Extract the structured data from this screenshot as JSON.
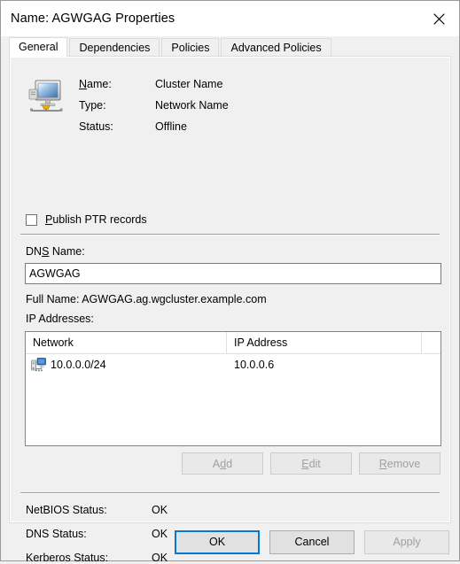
{
  "window": {
    "title": "Name: AGWGAG Properties",
    "close_icon": "close-icon"
  },
  "tabs": [
    {
      "label": "General",
      "active": true
    },
    {
      "label": "Dependencies",
      "active": false
    },
    {
      "label": "Policies",
      "active": false
    },
    {
      "label": "Advanced Policies",
      "active": false
    }
  ],
  "general": {
    "resource_icon": "network-name-resource-icon",
    "identity": [
      {
        "label": "Name:",
        "accel": "N",
        "value": "Cluster Name"
      },
      {
        "label": "Type:",
        "accel": "",
        "value": "Network Name"
      },
      {
        "label": "Status:",
        "accel": "",
        "value": "Offline"
      }
    ],
    "publish_ptr": {
      "label": "Publish PTR records",
      "accel": "P",
      "checked": false
    },
    "dns_name": {
      "label": "DNS Name:",
      "accel": "S",
      "value": "AGWGAG"
    },
    "full_name": "Full Name: AGWGAG.ag.wgcluster.example.com",
    "ip_addresses": {
      "label": "IP Addresses:",
      "columns": [
        "Network",
        "IP Address"
      ],
      "rows": [
        {
          "icon": "network-subnet-icon",
          "network": "10.0.0.0/24",
          "ip_address": "10.0.0.6"
        }
      ]
    },
    "list_buttons": [
      {
        "label": "Add",
        "accel": "d",
        "enabled": false
      },
      {
        "label": "Edit",
        "accel": "E",
        "enabled": false
      },
      {
        "label": "Remove",
        "accel": "R",
        "enabled": false
      }
    ],
    "status": [
      {
        "label": "NetBIOS Status:",
        "value": "OK"
      },
      {
        "label": "DNS Status:",
        "value": "OK"
      },
      {
        "label": "Kerberos Status:",
        "value": "OK"
      }
    ]
  },
  "footer": {
    "ok": "OK",
    "cancel": "Cancel",
    "apply": "Apply",
    "apply_enabled": false
  },
  "colors": {
    "accent": "#0078d7",
    "dialog_bg": "#f0f0f0",
    "titlebar_bg": "#ffffff",
    "field_bg": "#ffffff",
    "disabled_text": "#a0a0a0"
  }
}
